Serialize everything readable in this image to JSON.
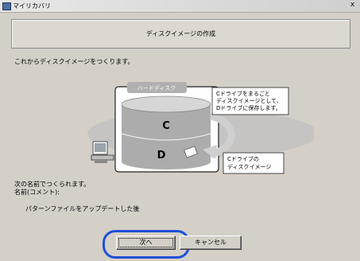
{
  "window": {
    "title": "マイリカバリ",
    "close_label": "x"
  },
  "header": {
    "title": "ディスクイメージの作成"
  },
  "intro": "これからディスクイメージをつくります。",
  "diagram": {
    "hdd_label": "ハードディスク",
    "drive_c": "C",
    "drive_d": "D",
    "callout_top": [
      "Cドライブをまるごと",
      "ディスクイメージとして、",
      "Dドライブに保存します。"
    ],
    "callout_bottom": [
      "Cドライブの",
      "ディスクイメージ"
    ]
  },
  "info": {
    "line1": "次の名前でつくられます。",
    "line2": "名前(コメント):",
    "comment_value": "",
    "pattern": "パターンファイルをアップデートした後"
  },
  "buttons": {
    "next": "次へ",
    "cancel": "キャンセル"
  },
  "colors": {
    "focus_ring": "#1f4fd6",
    "dialog_bg": "#d4d0c8"
  }
}
